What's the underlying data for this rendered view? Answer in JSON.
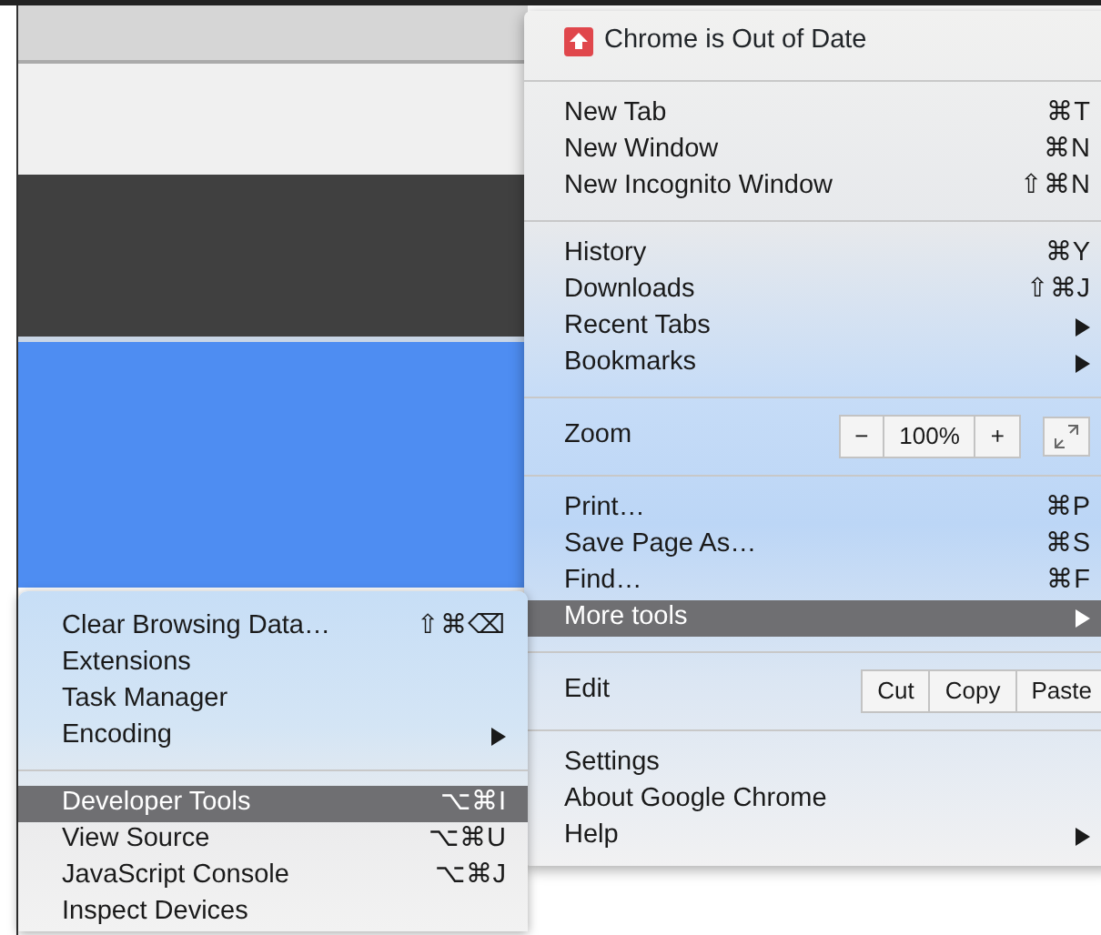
{
  "menu": {
    "header": {
      "text": "Chrome is Out of Date"
    },
    "sections": [
      [
        {
          "kind": "item",
          "label": "New Tab",
          "shortcut": "⌘T",
          "submenu": false,
          "selected": false
        },
        {
          "kind": "item",
          "label": "New Window",
          "shortcut": "⌘N",
          "submenu": false,
          "selected": false
        },
        {
          "kind": "item",
          "label": "New Incognito Window",
          "shortcut": "⇧⌘N",
          "submenu": false,
          "selected": false
        }
      ],
      [
        {
          "kind": "item",
          "label": "History",
          "shortcut": "⌘Y",
          "submenu": false,
          "selected": false
        },
        {
          "kind": "item",
          "label": "Downloads",
          "shortcut": "⇧⌘J",
          "submenu": false,
          "selected": false
        },
        {
          "kind": "item",
          "label": "Recent Tabs",
          "submenu": true,
          "selected": false
        },
        {
          "kind": "item",
          "label": "Bookmarks",
          "submenu": true,
          "selected": false
        }
      ],
      [
        {
          "kind": "zoom",
          "label": "Zoom",
          "minus": "−",
          "value": "100%",
          "plus": "+"
        }
      ],
      [
        {
          "kind": "item",
          "label": "Print…",
          "shortcut": "⌘P",
          "submenu": false,
          "selected": false
        },
        {
          "kind": "item",
          "label": "Save Page As…",
          "shortcut": "⌘S",
          "submenu": false,
          "selected": false
        },
        {
          "kind": "item",
          "label": "Find…",
          "shortcut": "⌘F",
          "submenu": false,
          "selected": false
        },
        {
          "kind": "item",
          "label": "More tools",
          "submenu": true,
          "selected": true
        }
      ],
      [
        {
          "kind": "edit",
          "label": "Edit",
          "buttons": [
            "Cut",
            "Copy",
            "Paste"
          ]
        }
      ],
      [
        {
          "kind": "item",
          "label": "Settings",
          "submenu": false,
          "selected": false
        },
        {
          "kind": "item",
          "label": "About Google Chrome",
          "submenu": false,
          "selected": false
        },
        {
          "kind": "item",
          "label": "Help",
          "submenu": true,
          "selected": false
        }
      ]
    ]
  },
  "submenu": {
    "sections": [
      [
        {
          "kind": "item",
          "label": "Clear Browsing Data…",
          "shortcut": "⇧⌘⌫",
          "submenu": false,
          "selected": false
        },
        {
          "kind": "item",
          "label": "Extensions",
          "submenu": false,
          "selected": false
        },
        {
          "kind": "item",
          "label": "Task Manager",
          "submenu": false,
          "selected": false
        },
        {
          "kind": "item",
          "label": "Encoding",
          "submenu": true,
          "selected": false
        }
      ],
      [
        {
          "kind": "item",
          "label": "Developer Tools",
          "shortcut": "⌥⌘I",
          "submenu": false,
          "selected": true
        },
        {
          "kind": "item",
          "label": "View Source",
          "shortcut": "⌥⌘U",
          "submenu": false,
          "selected": false
        },
        {
          "kind": "item",
          "label": "JavaScript Console",
          "shortcut": "⌥⌘J",
          "submenu": false,
          "selected": false
        },
        {
          "kind": "item",
          "label": "Inspect Devices",
          "submenu": false,
          "selected": false
        }
      ]
    ]
  }
}
